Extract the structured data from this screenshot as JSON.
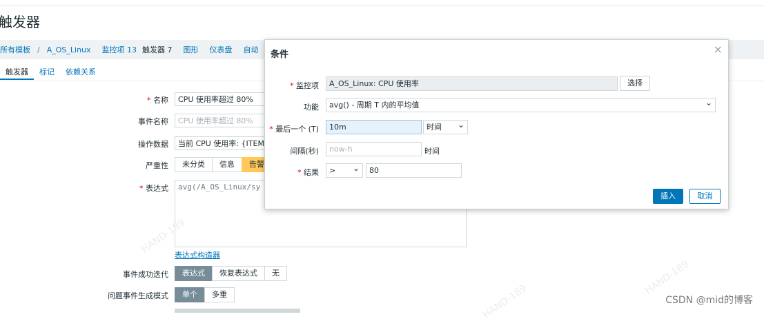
{
  "page": {
    "title": "触发器"
  },
  "breadcrumb": {
    "items": [
      "所有模板",
      "A_OS_Linux",
      "监控项 13",
      "触发器 7",
      "图形",
      "仪表盘",
      "自动"
    ],
    "separator": "/"
  },
  "tabs": [
    "触发器",
    "标记",
    "依赖关系"
  ],
  "form": {
    "name_label": "名称",
    "name_value": "CPU 使用率超过 80%",
    "event_name_label": "事件名称",
    "event_name_placeholder": "CPU 使用率超过 80%",
    "opdata_label": "操作数据",
    "opdata_value": "当前 CPU 使用率: {ITEM",
    "severity_label": "严重性",
    "severity_options": [
      "未分类",
      "信息",
      "告警"
    ],
    "expression_label": "表达式",
    "expression_value": "avg(/A_OS_Linux/sy",
    "expression_builder_link": "表达式构造器",
    "ok_event_label": "事件成功迭代",
    "ok_event_options": [
      "表达式",
      "恢复表达式",
      "无"
    ],
    "problem_mode_label": "问题事件生成模式",
    "problem_mode_options": [
      "单个",
      "多重"
    ]
  },
  "modal": {
    "title": "条件",
    "item_label": "监控项",
    "item_value": "A_OS_Linux: CPU 使用率",
    "select_button": "选择",
    "function_label": "功能",
    "function_value": "avg() - 周期 T 内的平均值",
    "last_of_label": "最后一个 (T)",
    "last_of_value": "10m",
    "last_of_unit": "时间",
    "shift_label": "间隔(秒)",
    "shift_placeholder": "now-h",
    "shift_unit": "时间",
    "result_label": "结果",
    "result_operator": ">",
    "result_value": "80",
    "insert_button": "插入",
    "cancel_button": "取消",
    "close_glyph": "×"
  },
  "watermarks": [
    "HAND-189",
    "HAND-189",
    "HAND-189",
    "HAND-189",
    "HAND-189"
  ],
  "credit": "CSDN @mid的博客",
  "colors": {
    "accent": "#0275b8",
    "warning": "#ffc859",
    "segment_on": "#768d99"
  }
}
